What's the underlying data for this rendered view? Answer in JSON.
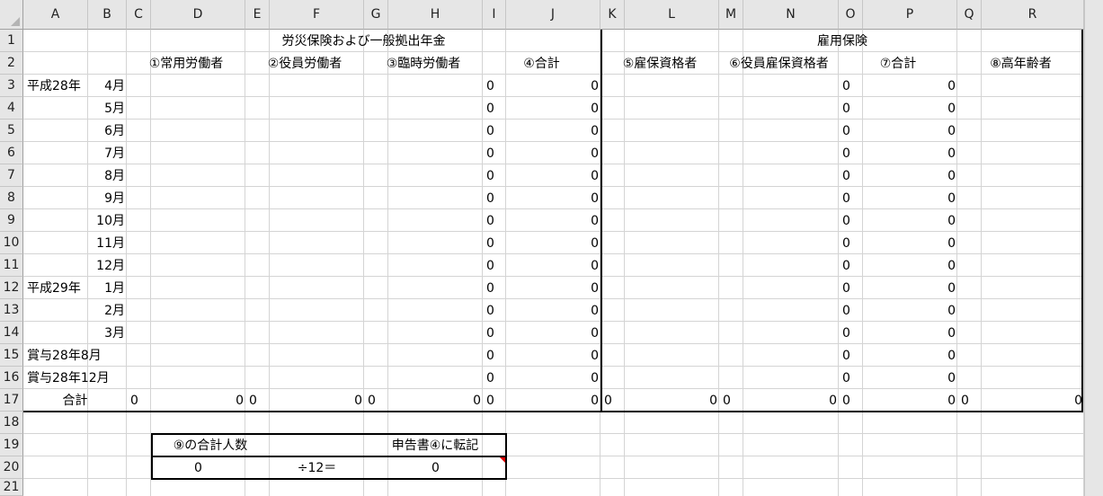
{
  "columns": [
    "A",
    "B",
    "C",
    "D",
    "E",
    "F",
    "G",
    "H",
    "I",
    "J",
    "K",
    "L",
    "M",
    "N",
    "O",
    "P",
    "Q",
    "R"
  ],
  "rows": [
    "1",
    "2",
    "3",
    "4",
    "5",
    "6",
    "7",
    "8",
    "9",
    "10",
    "11",
    "12",
    "13",
    "14",
    "15",
    "16",
    "17",
    "18",
    "19",
    "20",
    "21"
  ],
  "header": {
    "group1": "労災保険および一般拠出年金",
    "group2": "雇用保険",
    "sub": [
      "①常用労働者",
      "②役員労働者",
      "③臨時労働者",
      "④合計",
      "⑤雇保資格者",
      "⑥役員雇保資格者",
      "⑦合計",
      "⑧高年齢者"
    ]
  },
  "body": {
    "year28": "平成28年",
    "year29": "平成29年",
    "months": [
      "4月",
      "5月",
      "6月",
      "7月",
      "8月",
      "9月",
      "10月",
      "11月",
      "12月",
      "1月",
      "2月",
      "3月"
    ],
    "bonus1": "賞与28年8月",
    "bonus2": "賞与28年12月",
    "total_label": "合計",
    "zero": "0"
  },
  "summary": {
    "label_left": "⑨の合計人数",
    "label_right": "申告書④に転記",
    "value_left": "0",
    "divisor": "÷12＝",
    "value_right": "0"
  },
  "colors": {
    "grid": "#d4d4d4",
    "header_bg": "#e6e6e6",
    "border": "#000000",
    "comment": "#e00000"
  }
}
